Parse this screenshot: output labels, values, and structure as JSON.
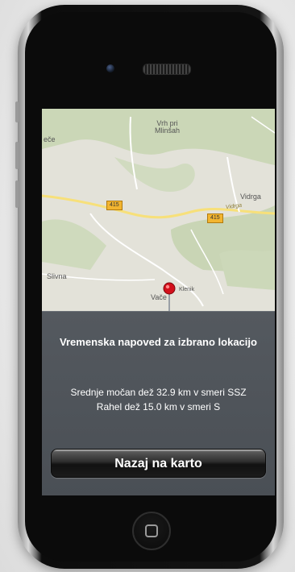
{
  "map": {
    "labels": {
      "vrh_pri_minsah": "Vrh pri\nMlinšah",
      "vidrga": "Vidrga",
      "vidrga_road": "Vidrga",
      "slivna": "Slivna",
      "vace": "Vače",
      "klenik": "Klenik",
      "edge_left": "eče"
    },
    "road_numbers": [
      "415",
      "415"
    ]
  },
  "panel": {
    "title": "Vremenska napoved za izbrano lokacijo",
    "forecast_lines": [
      "Srednje močan dež 32.9 km v smeri SSZ",
      "Rahel dež 15.0 km v smeri S"
    ],
    "back_button_label": "Nazaj na karto"
  },
  "colors": {
    "panel_bg": "#4d5258",
    "map_bg": "#e8e6df",
    "pin_red": "#d3101b"
  }
}
